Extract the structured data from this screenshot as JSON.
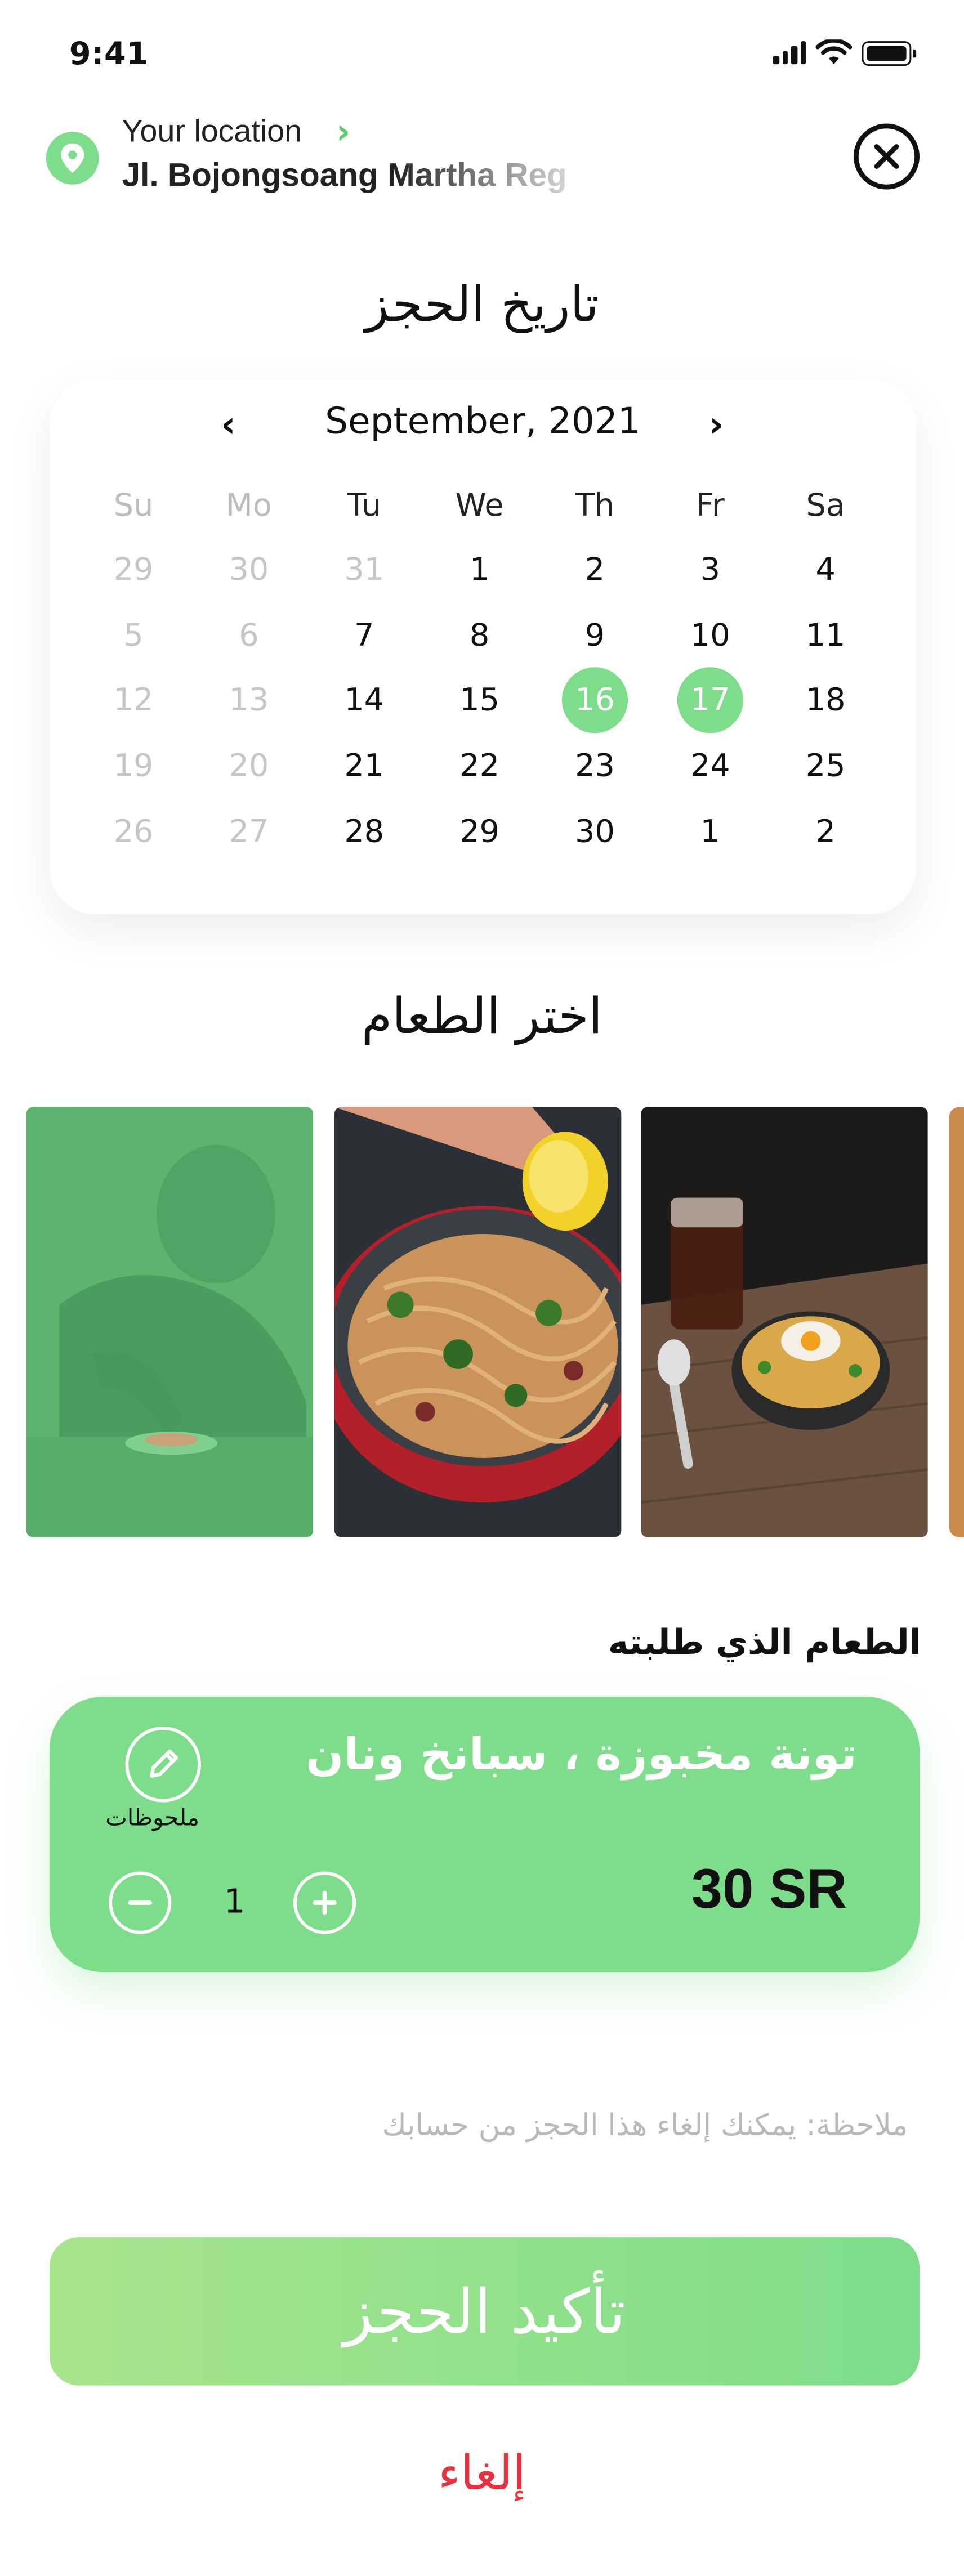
{
  "status_bar": {
    "time": "9:41"
  },
  "location": {
    "label": "Your location",
    "address": "Jl. Bojongsoang Martha Reg"
  },
  "booking_date": {
    "title": "تاريخ الحجز",
    "month_label": "September, 2021",
    "weekdays": [
      "Su",
      "Mo",
      "Tu",
      "We",
      "Th",
      "Fr",
      "Sa"
    ],
    "weeks": [
      [
        "29",
        "30",
        "31",
        "1",
        "2",
        "3",
        "4"
      ],
      [
        "5",
        "6",
        "7",
        "8",
        "9",
        "10",
        "11"
      ],
      [
        "12",
        "13",
        "14",
        "15",
        "16",
        "17",
        "18"
      ],
      [
        "19",
        "20",
        "21",
        "22",
        "23",
        "24",
        "25"
      ],
      [
        "26",
        "27",
        "28",
        "29",
        "30",
        "1",
        "2"
      ]
    ],
    "selected_days": [
      "16",
      "17"
    ]
  },
  "choose_food": {
    "title": "اختر الطعام"
  },
  "ordered": {
    "section_label": "الطعام الذي طلبته",
    "item_name": "تونة مخبوزة ، سبانخ ونان",
    "price": "30 SR",
    "notes_label": "ملحوظات",
    "quantity": "1"
  },
  "note": "ملاحظة: يمكنك إلغاء هذا الحجز من حسابك",
  "confirm_label": "تأكيد الحجز",
  "cancel_label": "إلغاء",
  "colors": {
    "accent": "#7ddd8a",
    "cancel": "#e8303f",
    "muted": "#c6c6c6"
  }
}
